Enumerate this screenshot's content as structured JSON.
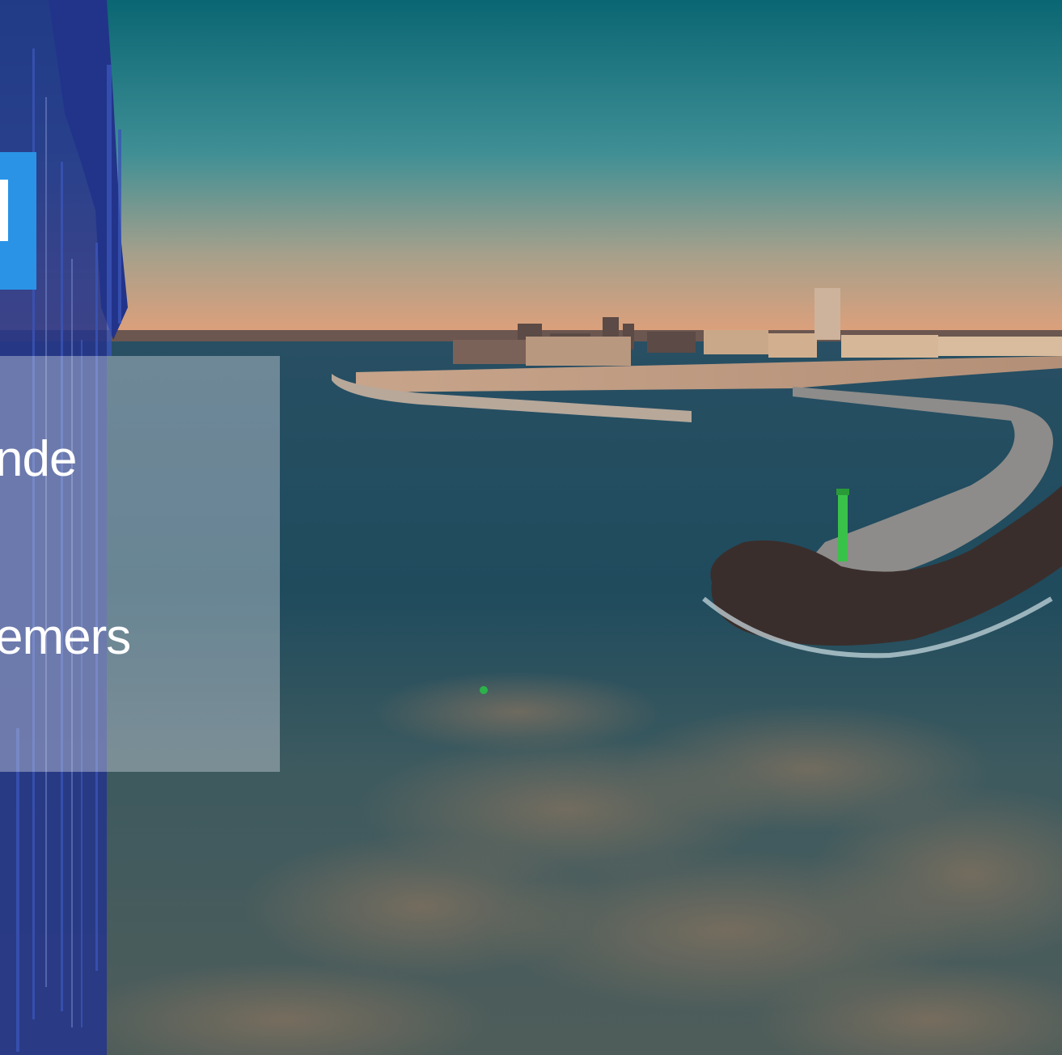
{
  "panel": {
    "line_1": "nde",
    "line_2": "emers"
  },
  "colors": {
    "accent_blue": "#2a93e6",
    "brush_navy": "#2a3a8a",
    "sky_top": "#0e6a7a",
    "horizon_glow": "#e8a37a",
    "sea": "#1c4a5a"
  }
}
